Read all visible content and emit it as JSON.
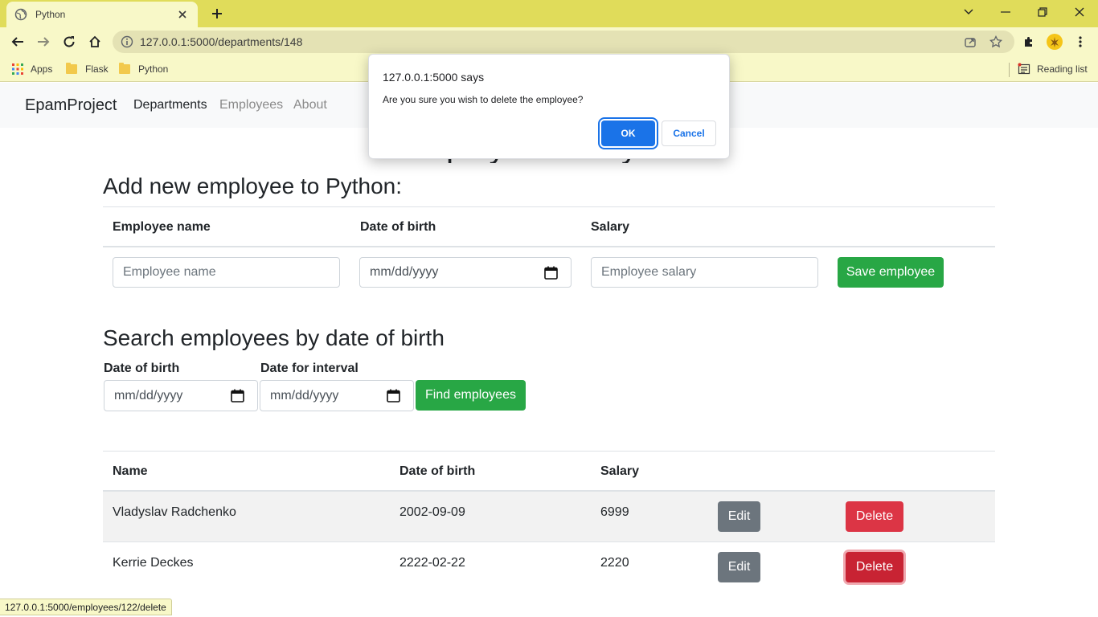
{
  "browser": {
    "tab_title": "Python",
    "url": "127.0.0.1:5000/departments/148",
    "bookmarks": [
      {
        "label": "Apps"
      },
      {
        "label": "Flask"
      },
      {
        "label": "Python"
      }
    ],
    "reading_list": "Reading list",
    "status_url": "127.0.0.1:5000/employees/122/delete",
    "frame_color": "#e0dc5a"
  },
  "navbar": {
    "brand": "EpamProject",
    "links": [
      {
        "label": "Departments",
        "active": true
      },
      {
        "label": "Employees",
        "active": false
      },
      {
        "label": "About",
        "active": false
      }
    ]
  },
  "page": {
    "title": "Employees in Python",
    "add_form": {
      "heading": "Add new employee to Python:",
      "headers": [
        "Employee name",
        "Date of birth",
        "Salary"
      ],
      "name_placeholder": "Employee name",
      "dob_placeholder": "mm/dd/yyyy",
      "salary_placeholder": "Employee salary",
      "save_label": "Save employee"
    },
    "search": {
      "heading": "Search employees by date of birth",
      "dob_label": "Date of birth",
      "interval_label": "Date for interval",
      "dob_placeholder": "mm/dd/yyyy",
      "interval_placeholder": "mm/dd/yyyy",
      "find_label": "Find employees"
    },
    "table": {
      "headers": [
        "Name",
        "Date of birth",
        "Salary"
      ],
      "rows": [
        {
          "name": "Vladyslav Radchenko",
          "dob": "2002-09-09",
          "salary": "6999",
          "edit": "Edit",
          "delete": "Delete"
        },
        {
          "name": "Kerrie Deckes",
          "dob": "2222-02-22",
          "salary": "2220",
          "edit": "Edit",
          "delete": "Delete"
        }
      ]
    }
  },
  "dialog": {
    "title": "127.0.0.1:5000 says",
    "message": "Are you sure you wish to delete the employee?",
    "ok_label": "OK",
    "cancel_label": "Cancel"
  },
  "colors": {
    "success": "#28a745",
    "secondary": "#6c757d",
    "danger": "#dc3545",
    "dialog_primary": "#1a73e8"
  }
}
